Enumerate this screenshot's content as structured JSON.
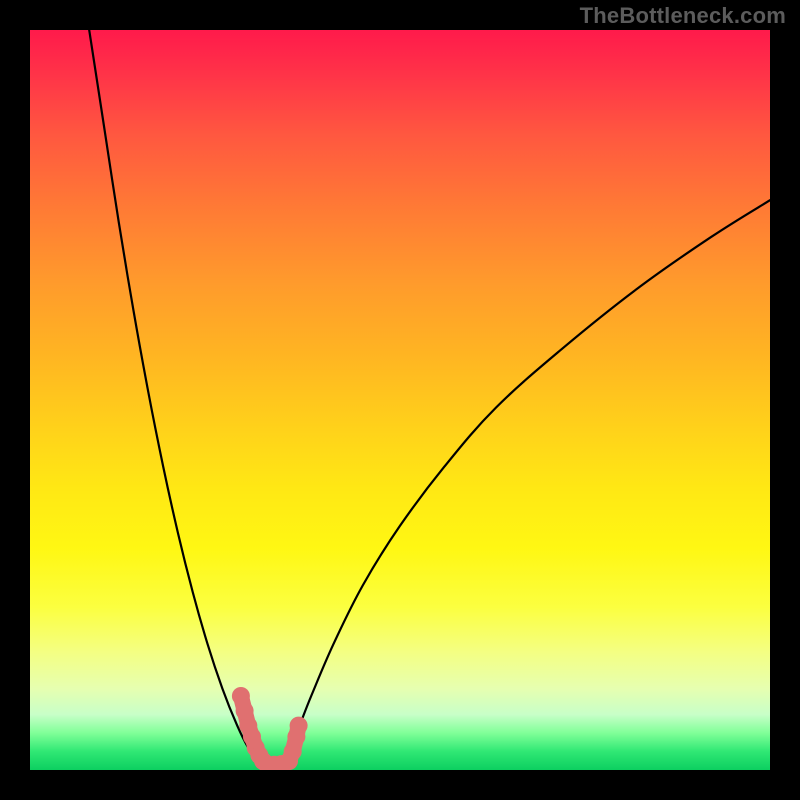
{
  "watermark": {
    "text": "TheBottleneck.com"
  },
  "chart_data": {
    "type": "line",
    "title": "",
    "xlabel": "",
    "ylabel": "",
    "xlim": [
      0,
      100
    ],
    "ylim": [
      0,
      100
    ],
    "grid": false,
    "legend": false,
    "series": [
      {
        "name": "curve-left",
        "color": "#000000",
        "x": [
          8,
          10,
          12,
          14,
          16,
          18,
          20,
          22,
          24,
          26,
          28,
          29.5,
          31
        ],
        "y": [
          100,
          87,
          74,
          62,
          51,
          41,
          32,
          24,
          17,
          11,
          6,
          3,
          1
        ]
      },
      {
        "name": "curve-right",
        "color": "#000000",
        "x": [
          33,
          34,
          36,
          38,
          41,
          45,
          50,
          56,
          63,
          72,
          82,
          92,
          100
        ],
        "y": [
          0.5,
          1,
          5,
          10,
          17,
          25,
          33,
          41,
          49,
          57,
          65,
          72,
          77
        ]
      },
      {
        "name": "marker-strip",
        "color": "#e07070",
        "style": "thick-round",
        "x": [
          28.5,
          29,
          29.5,
          30,
          30.5,
          31,
          31.5,
          32,
          33,
          34,
          35,
          35.5,
          36,
          36.3
        ],
        "y": [
          10,
          8,
          6,
          4.5,
          3,
          2,
          1.2,
          0.8,
          0.7,
          0.8,
          1.2,
          2.5,
          4.5,
          6
        ]
      }
    ]
  }
}
